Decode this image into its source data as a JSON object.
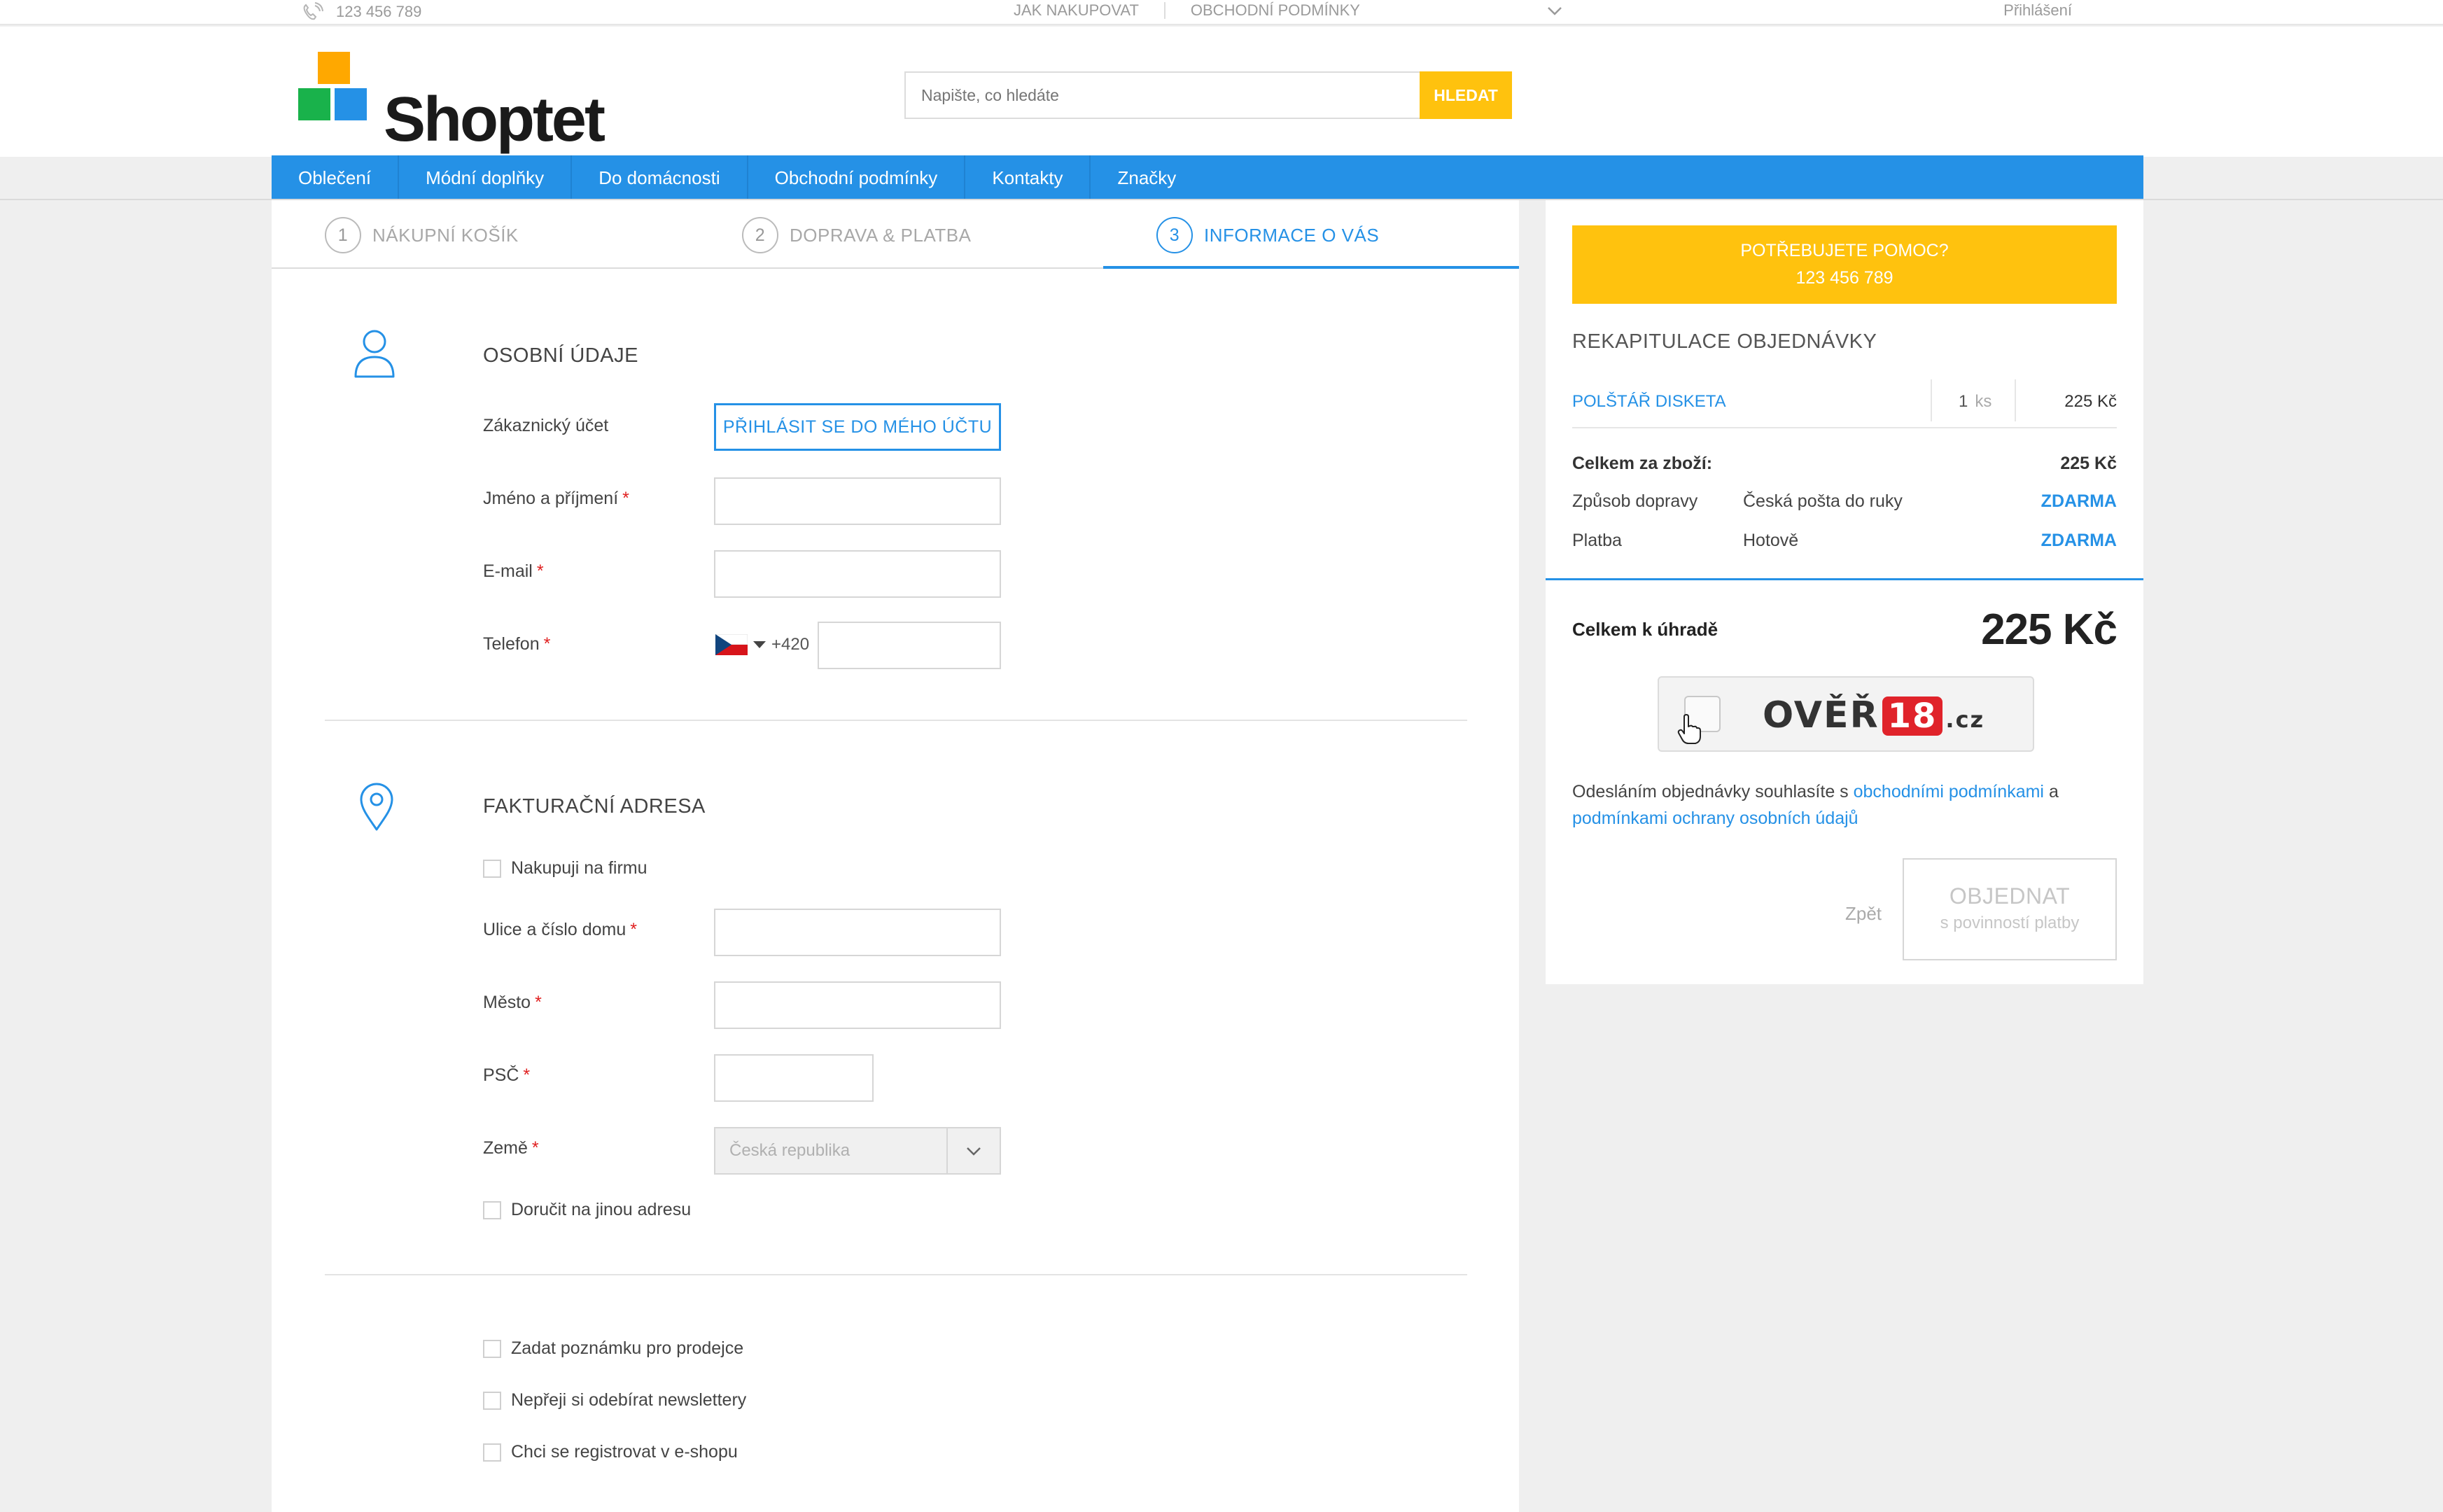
{
  "topbar": {
    "phone": "123 456 789",
    "links": [
      "JAK NAKUPOVAT",
      "OBCHODNÍ PODMÍNKY"
    ],
    "login": "Přihlášení"
  },
  "header": {
    "logo_text": "Shoptet",
    "search_placeholder": "Napište, co hledáte",
    "search_button": "HLEDAT"
  },
  "nav": {
    "items": [
      "Oblečení",
      "Módní doplňky",
      "Do domácnosti",
      "Obchodní podmínky",
      "Kontakty",
      "Značky"
    ]
  },
  "steps": [
    {
      "num": "1",
      "label": "NÁKUPNÍ KOŠÍK"
    },
    {
      "num": "2",
      "label": "DOPRAVA & PLATBA"
    },
    {
      "num": "3",
      "label": "INFORMACE O VÁS"
    }
  ],
  "personal": {
    "title": "OSOBNÍ ÚDAJE",
    "account_label": "Zákaznický účet",
    "login_button": "PŘIHLÁSIT SE DO MÉHO ÚČTU",
    "name_label": "Jméno a příjmení",
    "email_label": "E-mail",
    "phone_label": "Telefon",
    "phone_prefix": "+420",
    "required_mark": "*"
  },
  "billing": {
    "title": "FAKTURAČNÍ ADRESA",
    "company_checkbox": "Nakupuji na firmu",
    "street_label": "Ulice a číslo domu",
    "city_label": "Město",
    "zip_label": "PSČ",
    "country_label": "Země",
    "country_value": "Česká republika",
    "other_address_checkbox": "Doručit na jinou adresu"
  },
  "extras": {
    "note_checkbox": "Zadat poznámku pro prodejce",
    "newsletter_checkbox": "Nepřeji si odebírat newslettery",
    "register_checkbox": "Chci se registrovat v e-shopu"
  },
  "sidebar": {
    "help_line1": "POTŘEBUJETE POMOC?",
    "help_line2": "123 456 789",
    "recap_title": "REKAPITULACE OBJEDNÁVKY",
    "product_name": "POLŠTÁŘ DISKETA",
    "product_qty": "1",
    "product_unit": "ks",
    "product_price": "225 Kč",
    "goods_total_label": "Celkem za zboží:",
    "goods_total_value": "225 Kč",
    "shipping_label": "Způsob dopravy",
    "shipping_method": "Česká pošta do ruky",
    "shipping_price": "ZDARMA",
    "payment_label": "Platba",
    "payment_method": "Hotově",
    "payment_price": "ZDARMA",
    "total_label": "Celkem k úhradě",
    "total_value": "225 Kč",
    "verify_text_a": "OVĚŘ",
    "verify_text_badge": "18",
    "verify_text_b": ".cz",
    "consent_text_1": "Odesláním objednávky souhlasíte s ",
    "consent_link_1": "obchodními podmínkami",
    "consent_text_2": " a",
    "consent_link_2": "podmínkami ochrany osobních údajů",
    "back_link": "Zpět",
    "order_button_l1": "OBJEDNAT",
    "order_button_l2": "s povinností platby"
  },
  "colors": {
    "brand_blue": "#2591e6",
    "accent_yellow": "#ffc20e",
    "required_red": "#e02020"
  }
}
